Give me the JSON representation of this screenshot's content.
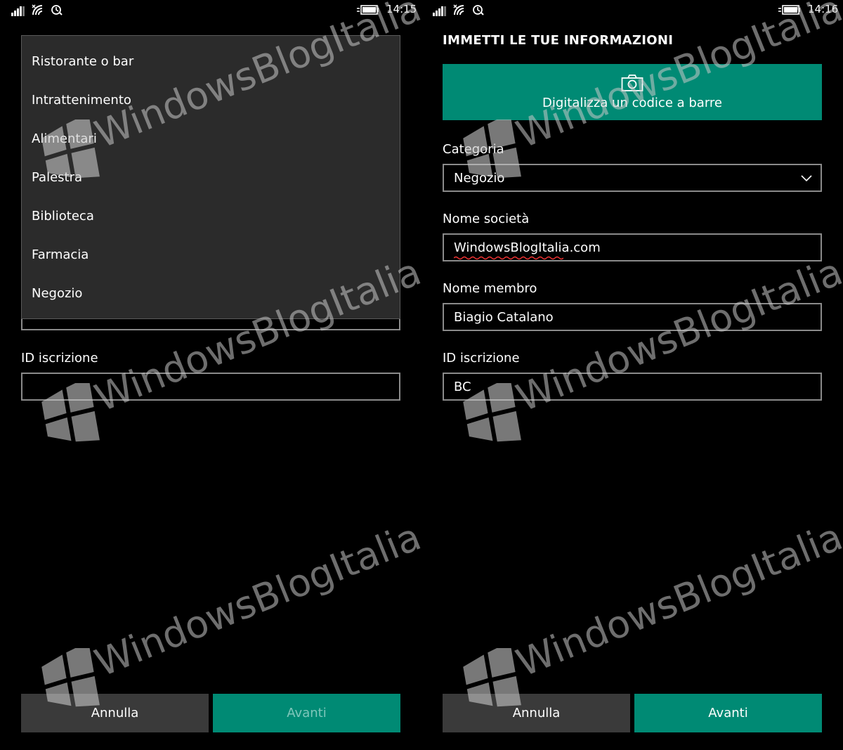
{
  "left": {
    "status": {
      "time": "14:15"
    },
    "dropdown_options": [
      "Ristorante o bar",
      "Intrattenimento",
      "Alimentari",
      "Palestra",
      "Biblioteca",
      "Farmacia",
      "Negozio"
    ],
    "id_label": "ID iscrizione",
    "id_value": "",
    "cancel_label": "Annulla",
    "next_label": "Avanti"
  },
  "right": {
    "status": {
      "time": "14:16"
    },
    "title": "IMMETTI LE TUE INFORMAZIONI",
    "scan_label": "Digitalizza un codice a barre",
    "category_label": "Categoria",
    "category_value": "Negozio",
    "company_label": "Nome società",
    "company_value": "WindowsBlogItalia.com",
    "member_label": "Nome membro",
    "member_value": "Biagio Catalano",
    "id_label": "ID iscrizione",
    "id_value": "BC",
    "cancel_label": "Annulla",
    "next_label": "Avanti"
  },
  "watermark": "WindowsBlogItalia",
  "colors": {
    "accent": "#008a74",
    "field_border": "#8a8a8a",
    "dropdown_bg": "#2b2b2b"
  },
  "icons": [
    "signal-icon",
    "wifi-icon",
    "quiet-hours-icon",
    "battery-icon",
    "camera-icon",
    "chevron-down-icon"
  ]
}
